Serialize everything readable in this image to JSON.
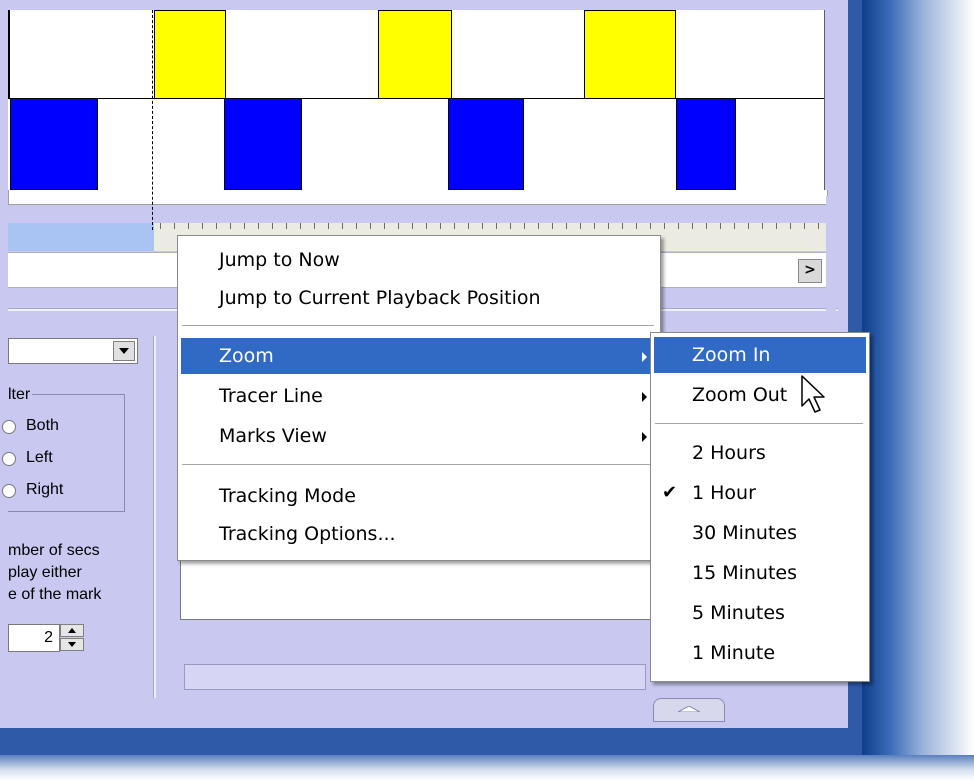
{
  "colors": {
    "window_frame": "#2f5aa8",
    "client_bg": "#c8c8f0",
    "block_yellow": "#ffff00",
    "block_blue": "#0000ff",
    "menu_highlight": "#316ac5"
  },
  "scroll": {
    "right_arrow_label": ">"
  },
  "filter": {
    "group_label": "lter",
    "options": [
      {
        "label": "Both"
      },
      {
        "label": "Left"
      },
      {
        "label": "Right"
      }
    ]
  },
  "info": {
    "lines": [
      "mber of secs",
      "play either",
      "e of the mark"
    ]
  },
  "spinner": {
    "value": "2"
  },
  "context_menu": {
    "items": [
      {
        "label": "Jump to Now"
      },
      {
        "label": "Jump to Current Playback Position"
      },
      {
        "label": "Zoom",
        "submenu": true,
        "selected": true
      },
      {
        "label": "Tracer Line",
        "submenu": true
      },
      {
        "label": "Marks View",
        "submenu": true
      },
      {
        "label": "Tracking Mode"
      },
      {
        "label": "Tracking Options..."
      }
    ]
  },
  "zoom_menu": {
    "items": [
      {
        "label": "Zoom In",
        "selected": true
      },
      {
        "label": "Zoom Out"
      },
      {
        "label": "2 Hours"
      },
      {
        "label": "1 Hour",
        "checked": true
      },
      {
        "label": "30 Minutes"
      },
      {
        "label": "15 Minutes"
      },
      {
        "label": "5 Minutes"
      },
      {
        "label": "1 Minute"
      }
    ],
    "check_glyph": "✔"
  }
}
